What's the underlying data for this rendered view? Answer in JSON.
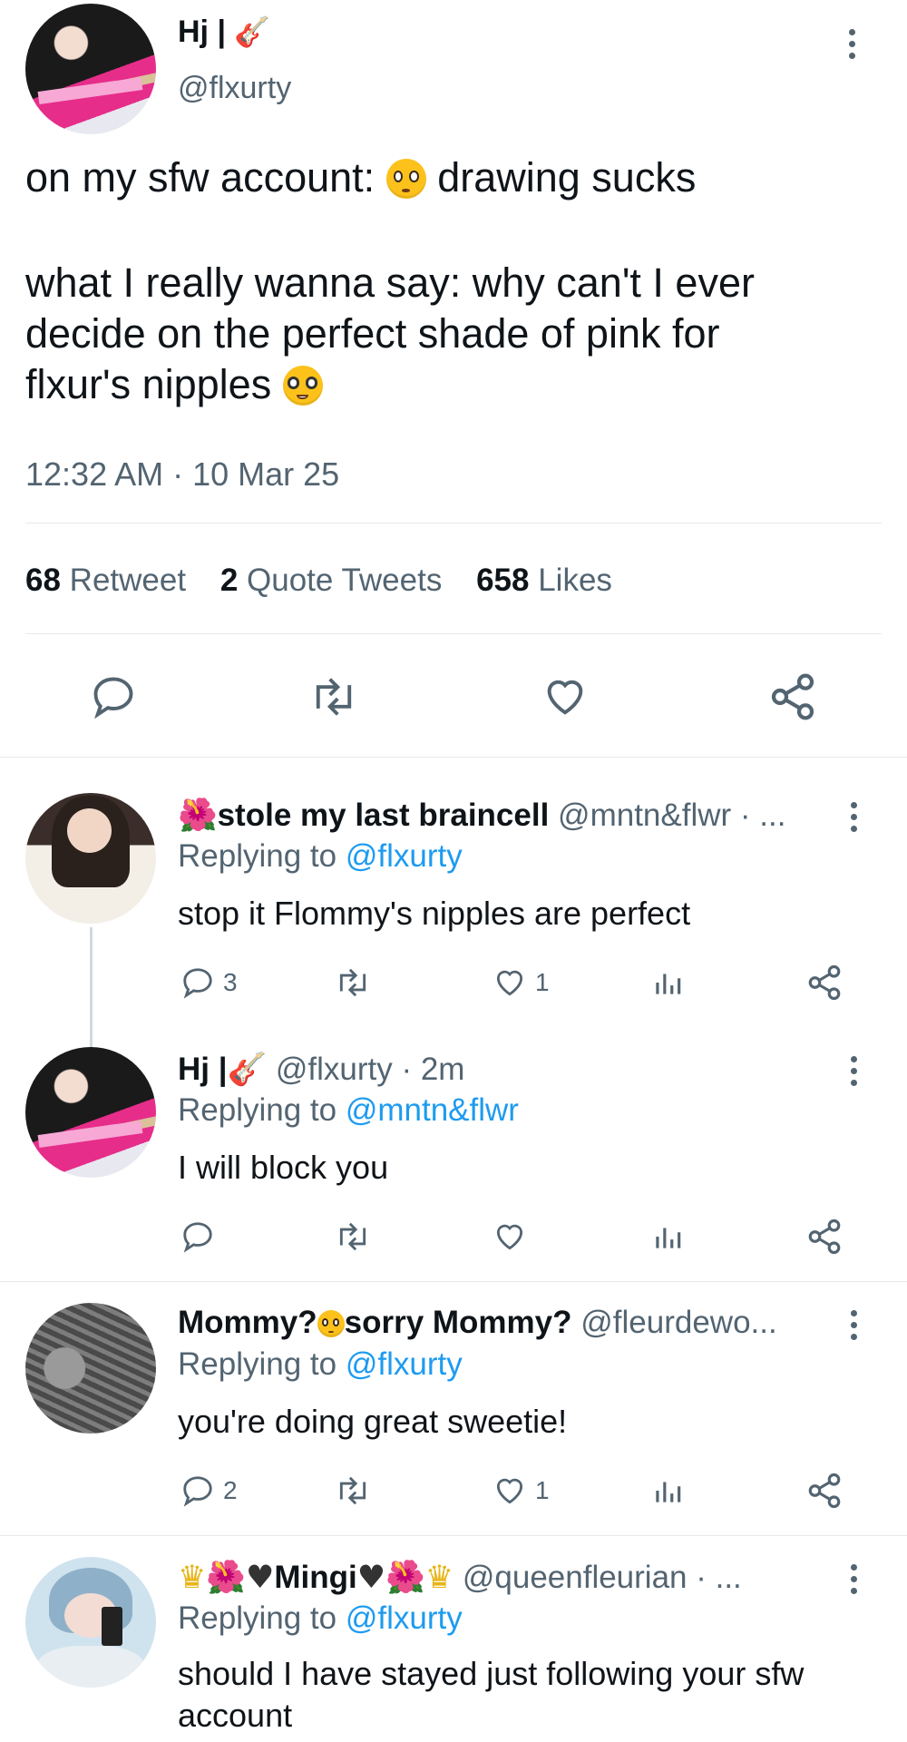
{
  "main_tweet": {
    "display_name": "Hj |",
    "name_emoji": "guitar",
    "handle": "@flxurty",
    "text_line1a": "on my sfw account:",
    "text_line1b": "drawing sucks",
    "text_line2": "what I really wanna say: why can't I ever",
    "text_line3": "decide on the perfect shade of pink for",
    "text_line4": "flxur's nipples",
    "timestamp": "12:32 AM · 10 Mar 25",
    "stats": {
      "retweets_count": "68",
      "retweets_label": "Retweet",
      "quotes_count": "2",
      "quotes_label": "Quote Tweets",
      "likes_count": "658",
      "likes_label": "Likes"
    }
  },
  "replies": [
    {
      "display_name": "stole my last braincell",
      "handle_time": "@mntn&flwr · ...",
      "replying_prefix": "Replying to",
      "replying_to": "@flxurty",
      "text": "stop it Flommy's nipples are perfect",
      "reply_count": "3",
      "like_count": "1"
    },
    {
      "display_name": "Hj |",
      "handle_time": "@flxurty · 2m",
      "replying_prefix": "Replying to",
      "replying_to": "@mntn&flwr",
      "text": "I will block you",
      "reply_count": "",
      "like_count": ""
    },
    {
      "display_name_a": "Mommy?",
      "display_name_b": "sorry Mommy?",
      "handle_time": "@fleurdewo...",
      "replying_prefix": "Replying to",
      "replying_to": "@flxurty",
      "text": "you're doing great sweetie!",
      "reply_count": "2",
      "like_count": "1"
    },
    {
      "display_name": "Mingi",
      "handle_time": "@queenfleurian · ...",
      "replying_prefix": "Replying to",
      "replying_to": "@flxurty",
      "text_line1": "should I have stayed just following your sfw",
      "text_line2": "account"
    }
  ],
  "icons": {
    "reply": "reply-icon",
    "retweet": "retweet-icon",
    "like": "heart-icon",
    "share": "share-icon",
    "analytics": "analytics-icon",
    "more": "more-icon"
  },
  "colors": {
    "link": "#1d9bf0",
    "muted": "#536471",
    "text": "#0f1419"
  }
}
